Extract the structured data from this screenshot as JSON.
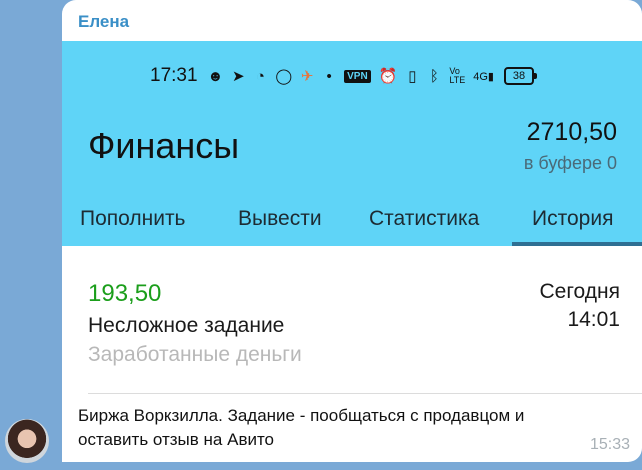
{
  "message": {
    "sender": "Елена",
    "caption": "Биржа Воркзилла. Задание - пообщаться с продавцом и оставить отзыв на Авито",
    "time": "15:33"
  },
  "screenshot": {
    "status_bar": {
      "time": "17:31",
      "vpn": "VPN",
      "battery": "38",
      "icons": [
        "emoji-app-icon",
        "telegram-icon",
        "signal-icon",
        "chat-icon",
        "plane-icon",
        "dot-icon",
        "vpn-icon",
        "alarm-icon",
        "vibrate-icon",
        "bluetooth-icon",
        "volte-icon",
        "network-4g-icon",
        "battery-icon"
      ]
    },
    "app": {
      "title": "Финансы",
      "balance": "2710,50",
      "buffer": "в буфере 0",
      "tabs": [
        "Пополнить",
        "Вывести",
        "Статистика",
        "История"
      ],
      "active_tab": "История"
    },
    "transaction": {
      "amount": "193,50",
      "title": "Несложное задание",
      "category": "Заработанные деньги",
      "date": "Сегодня",
      "time": "14:01"
    }
  },
  "colors": {
    "app_bar": "#5fd4f7",
    "amount_green": "#1b9e1b",
    "sender_blue": "#3a8fc7",
    "chat_bg": "#7aa9d6"
  }
}
